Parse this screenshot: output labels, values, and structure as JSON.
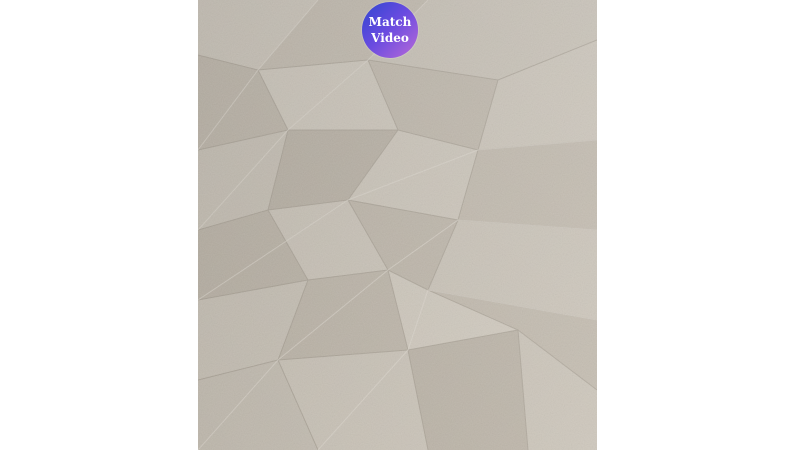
{
  "badge": {
    "line1": "Match",
    "line2": "Video",
    "gradient_colors": [
      "#2f46d0",
      "#6a4be0",
      "#b96ad8"
    ],
    "text_color": "#ffffff"
  },
  "background": {
    "page_color": "#ffffff",
    "paper_color": "#c9c1b5",
    "texture": "crumpled-kraft-paper"
  }
}
